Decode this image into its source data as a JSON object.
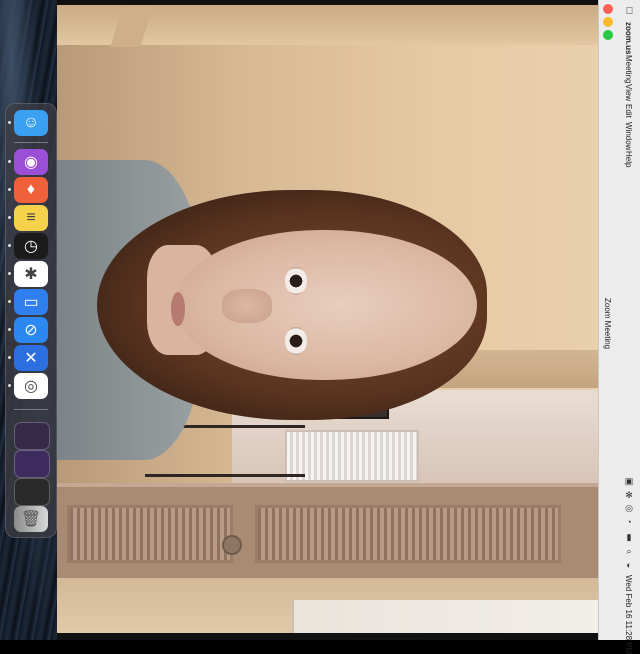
{
  "menubar": {
    "apple_icon": "apple-icon",
    "app_name": "zoom.us",
    "items": [
      "Meeting",
      "View",
      "Edit",
      "Window",
      "Help"
    ],
    "window_title": "Zoom Meeting",
    "clock": "Wed Feb 16  11:28 PM",
    "status_icons": [
      "zoom-icon",
      "bluetooth-icon",
      "airdrop-icon",
      "wifi-icon",
      "battery-icon",
      "control-center-icon",
      "search-icon",
      "siri-icon"
    ]
  },
  "window": {
    "traffic_lights": {
      "close": "#ff5f57",
      "minimize": "#febc2e",
      "zoom": "#28c840"
    }
  },
  "dock": {
    "apps": [
      {
        "name": "Finder",
        "icon": "finder-icon",
        "color": "#3aa0f2",
        "glyph": "☺"
      },
      {
        "name": "Podcasts",
        "icon": "podcasts-icon",
        "color": "#9a4fd6",
        "glyph": "◉"
      },
      {
        "name": "Brave",
        "icon": "brave-icon",
        "color": "#f0613a",
        "glyph": "♦"
      },
      {
        "name": "Notes",
        "icon": "notes-icon",
        "color": "#f6d24a",
        "glyph": "≡"
      },
      {
        "name": "Clock",
        "icon": "clock-icon",
        "color": "#1b1b1b",
        "glyph": "◷"
      },
      {
        "name": "Slack",
        "icon": "slack-icon",
        "color": "#ffffff",
        "glyph": "✱"
      },
      {
        "name": "Screen Sharing",
        "icon": "screen-sharing-icon",
        "color": "#2f7ff0",
        "glyph": "▭"
      },
      {
        "name": "Safari",
        "icon": "safari-icon",
        "color": "#2a88f0",
        "glyph": "⊘"
      },
      {
        "name": "Xcode-like",
        "icon": "cross-app-icon",
        "color": "#2c6fe0",
        "glyph": "✕"
      },
      {
        "name": "Chrome",
        "icon": "chrome-icon",
        "color": "#ffffff",
        "glyph": "◎"
      }
    ],
    "recents": [
      {
        "icon": "recent-window-1-icon",
        "color": "#352a4a"
      },
      {
        "icon": "recent-window-2-icon",
        "color": "#3c2b5c"
      },
      {
        "icon": "recent-window-3-icon",
        "color": "#2a2a2a"
      }
    ],
    "trash_icon": "trash-icon"
  }
}
